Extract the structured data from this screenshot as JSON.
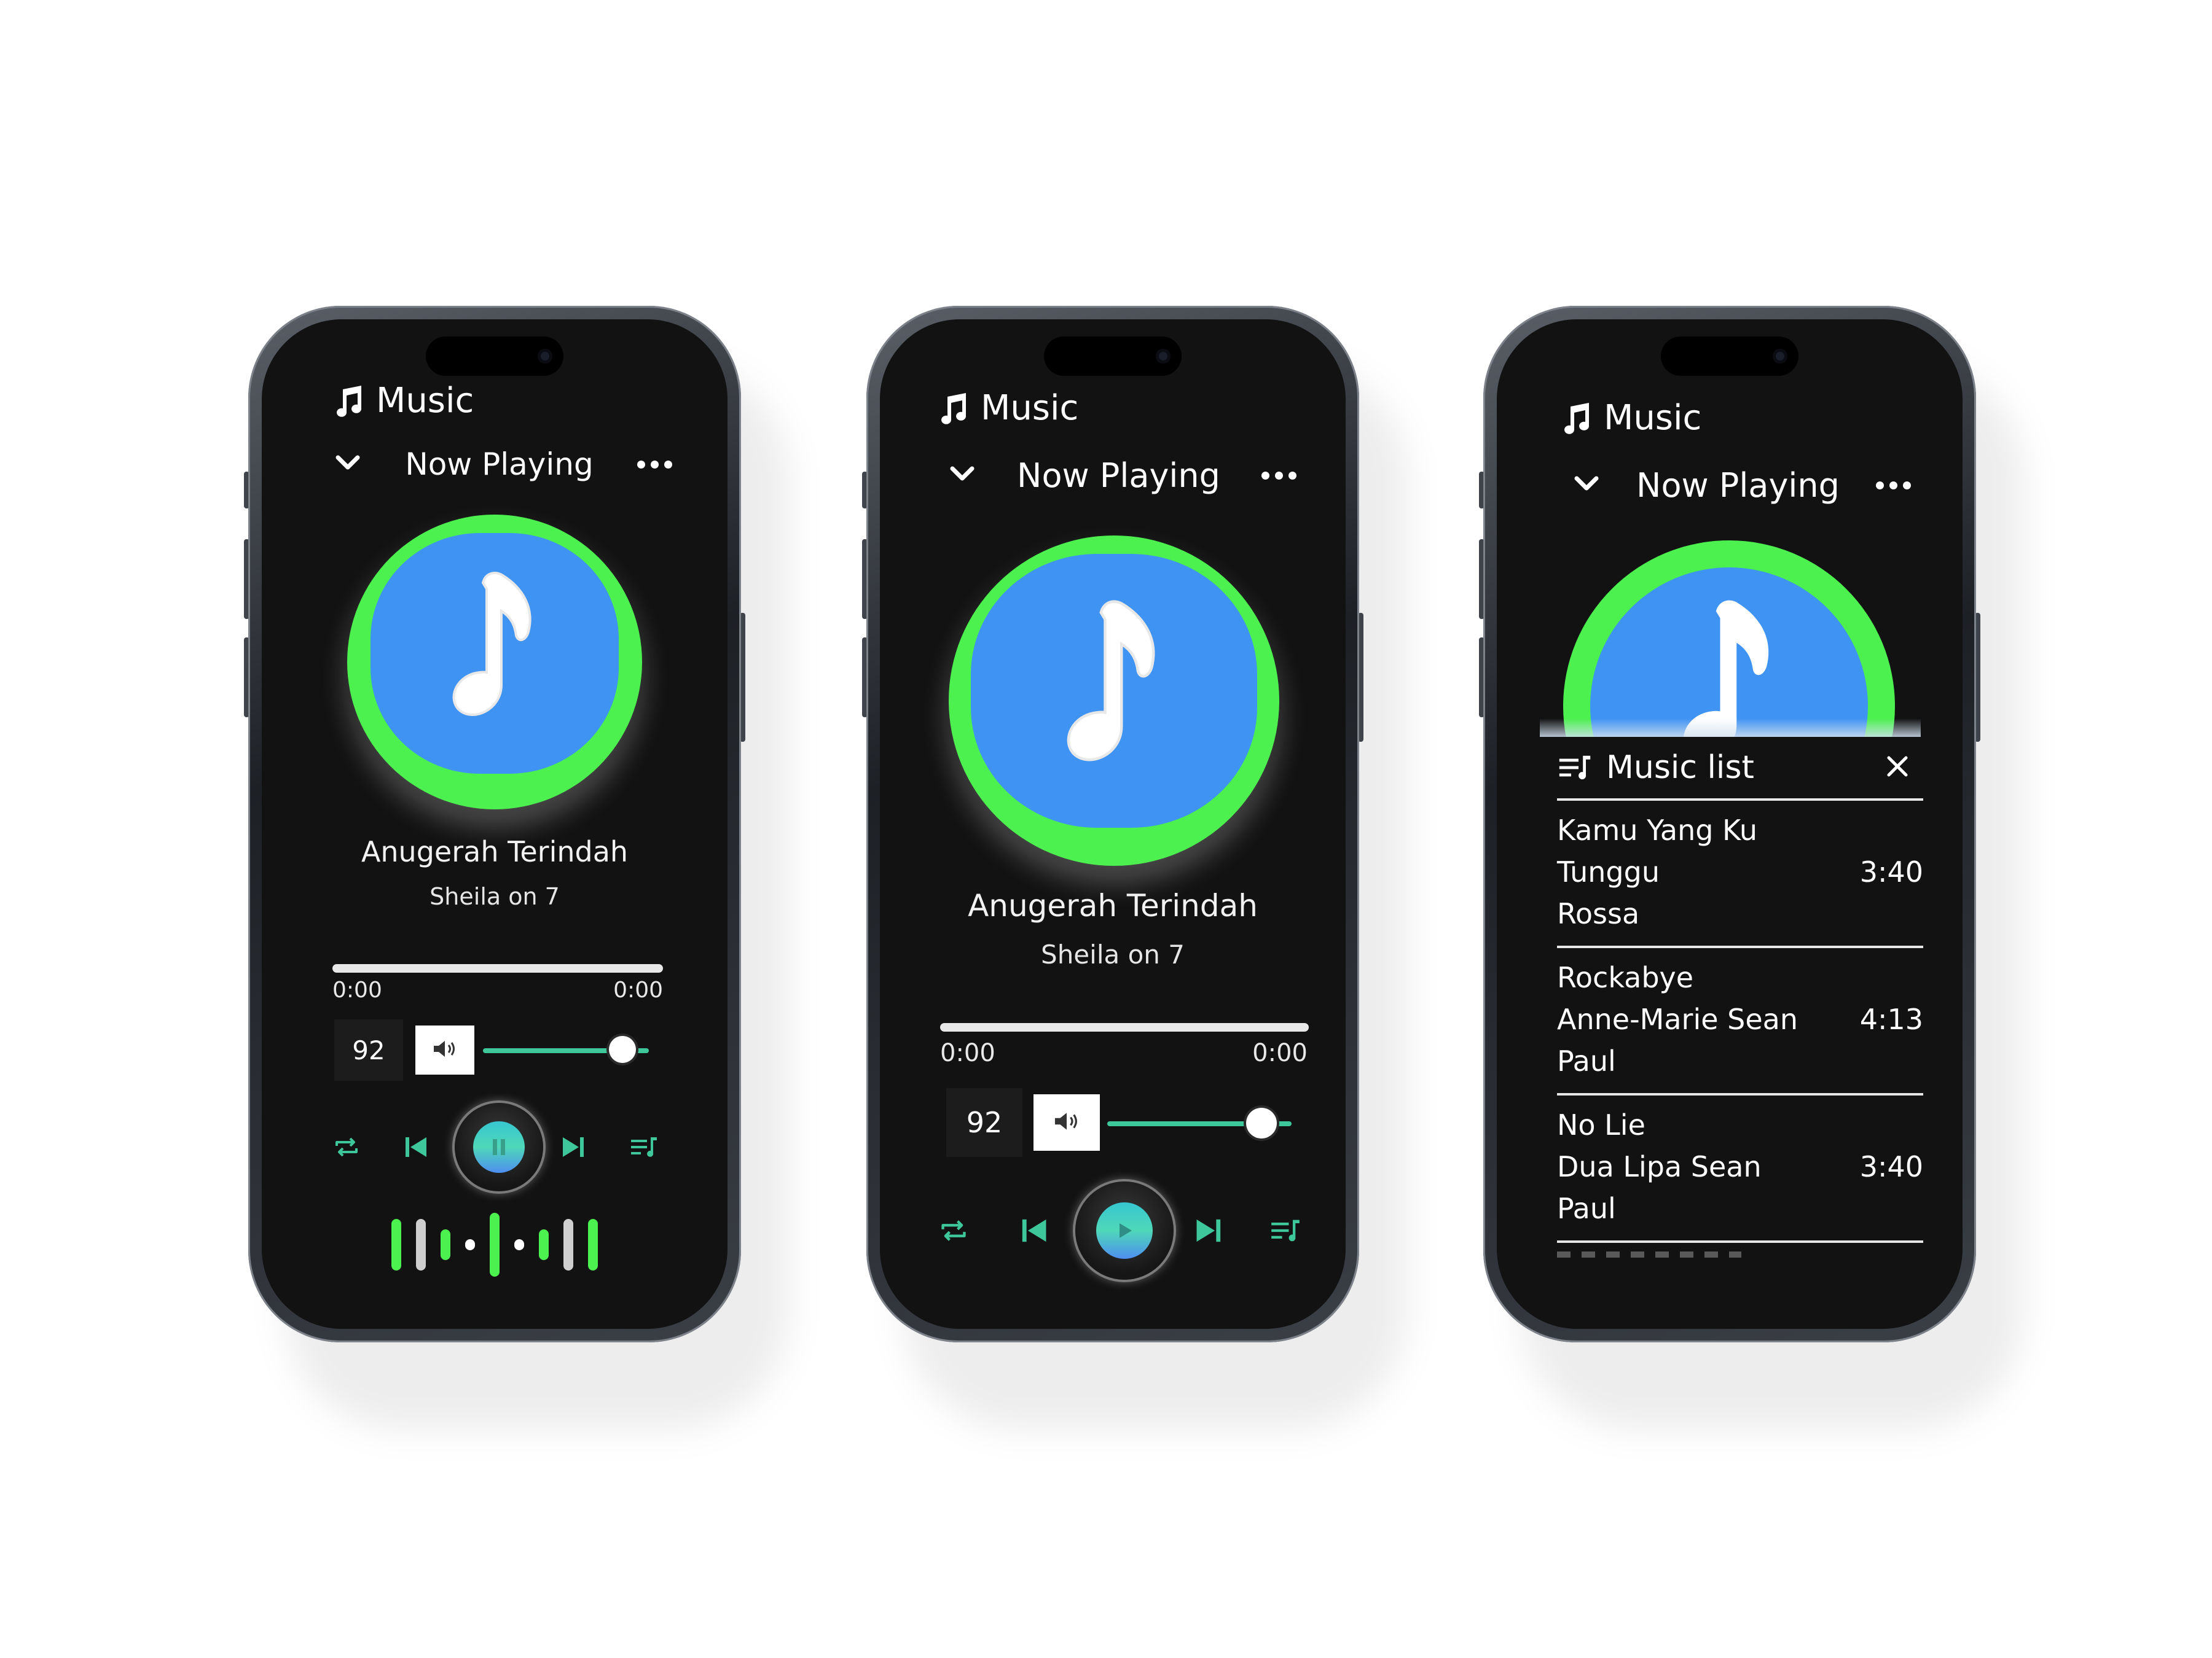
{
  "phones": [
    {
      "app_title": "Music",
      "nav": {
        "title": "Now Playing"
      },
      "song": {
        "title": "Anugerah Terindah",
        "artist": "Sheila on 7"
      },
      "progress": {
        "current": "0:00",
        "total": "0:00"
      },
      "volume": {
        "value": "92",
        "level": 0.85
      },
      "play_state": "pause-icon",
      "accent": "#4cf04f",
      "art_color": "#3f93f2"
    },
    {
      "app_title": "Music",
      "nav": {
        "title": "Now Playing"
      },
      "song": {
        "title": "Anugerah Terindah",
        "artist": "Sheila on 7"
      },
      "progress": {
        "current": "0:00",
        "total": "0:00"
      },
      "volume": {
        "value": "92",
        "level": 0.85
      },
      "play_state": "play-icon"
    },
    {
      "app_title": "Music",
      "nav": {
        "title": "Now Playing"
      },
      "music_list": {
        "title": "Music list",
        "items": [
          {
            "title": "Kamu Yang Ku Tunggu",
            "artist": "Rossa",
            "duration": "3:40"
          },
          {
            "title": "Rockabye",
            "artist": "Anne-Marie Sean Paul",
            "duration": "4:13"
          },
          {
            "title": "No Lie",
            "artist": "Dua Lipa Sean Paul",
            "duration": "3:40"
          }
        ]
      }
    }
  ]
}
